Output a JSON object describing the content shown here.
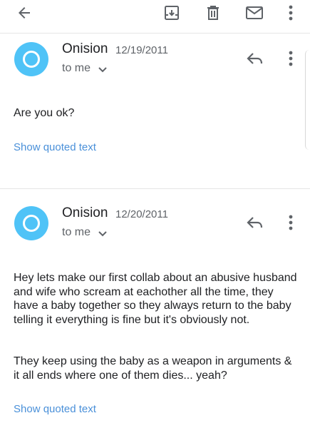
{
  "toolbar": {
    "back_icon": "arrow-left-icon",
    "archive_icon": "archive-icon",
    "delete_icon": "trash-icon",
    "mark_unread_icon": "envelope-icon",
    "more_icon": "more-vert-icon"
  },
  "colors": {
    "avatar": "#4fc3f7",
    "link": "#4a90d9",
    "secondary_text": "#5f6368"
  },
  "messages": [
    {
      "sender": "Onision",
      "date": "12/19/2011",
      "recipient": "to me",
      "paragraphs": [
        "Are you ok?"
      ],
      "show_quoted": "Show quoted text"
    },
    {
      "sender": "Onision",
      "date": "12/20/2011",
      "recipient": "to me",
      "paragraphs": [
        "Hey lets make our first collab about an abusive husband and wife who scream at eachother all the time, they have a baby together so they always return to the baby telling it everything is fine but it's obviously not.",
        "They keep using the baby as a weapon in arguments & it all ends where one of them dies... yeah?"
      ],
      "show_quoted": "Show quoted text"
    }
  ]
}
